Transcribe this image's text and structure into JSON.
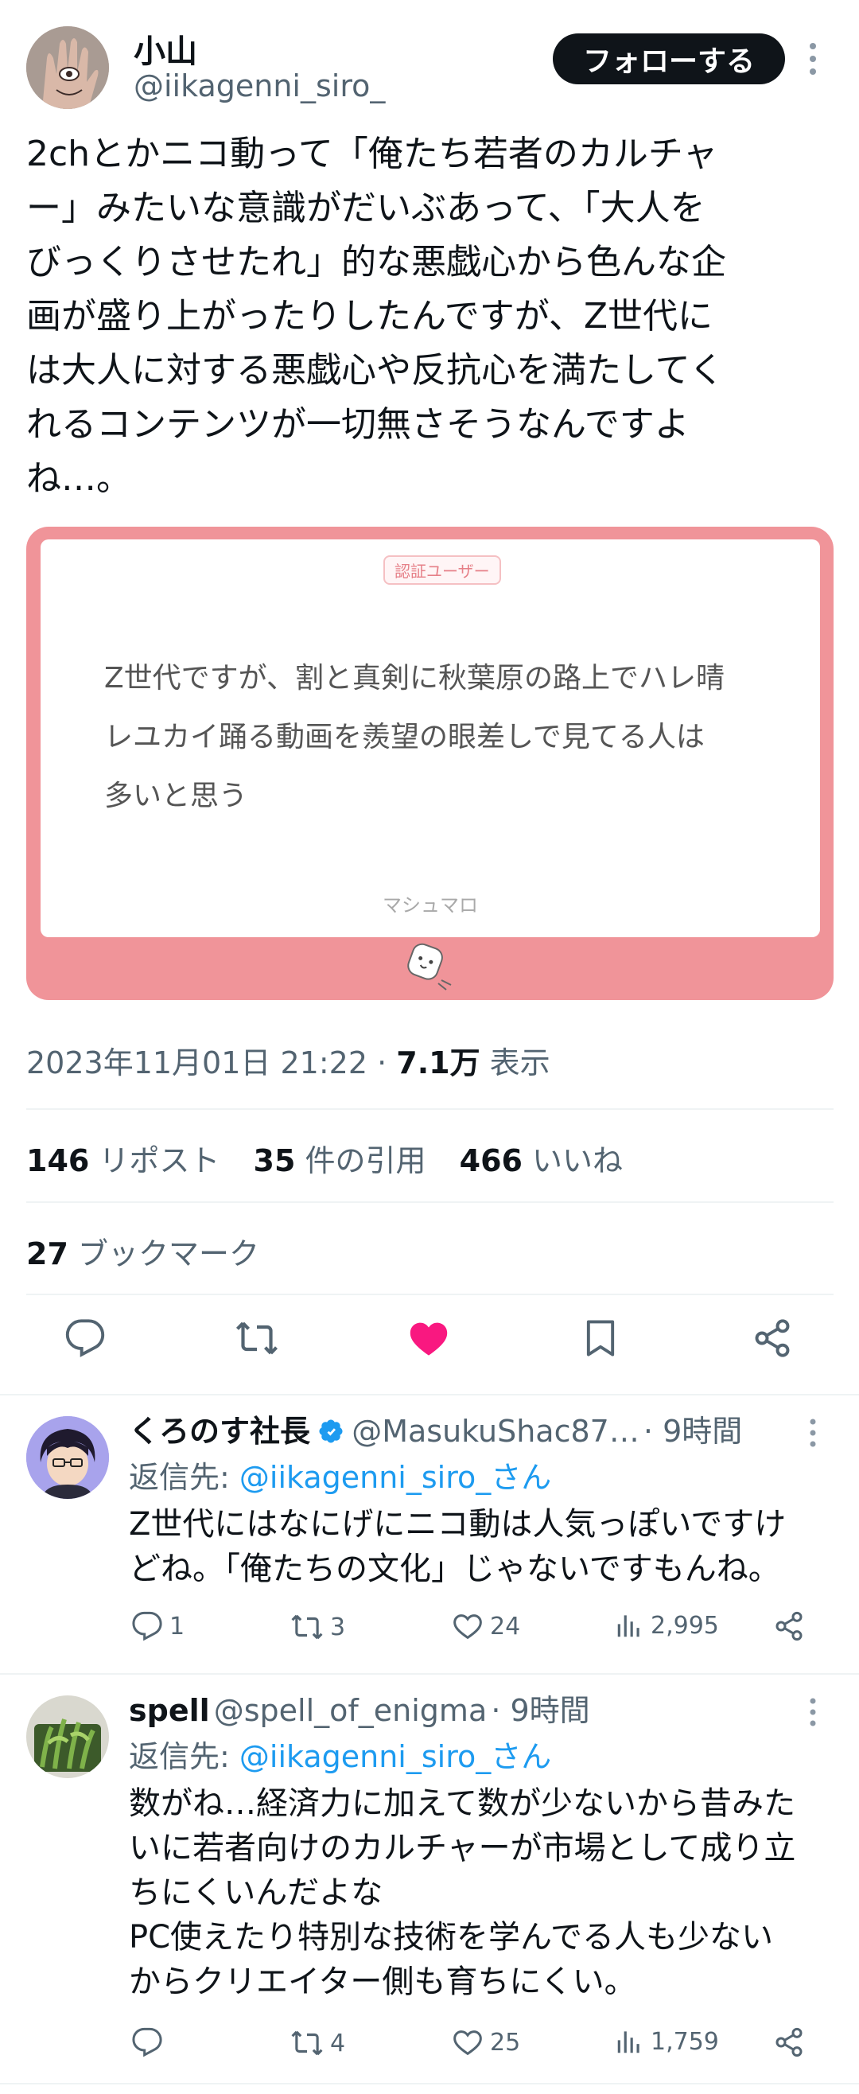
{
  "author": {
    "name": "小山",
    "handle": "@iikagenni_siro_",
    "follow_label": "フォローする"
  },
  "tweet": {
    "text": "2chとかニコ動って「俺たち若者のカルチャ\nー」みたいな意識がだいぶあって、「大人を\nびっくりさせたれ」的な悪戯心から色んな企\n画が盛り上がったりしたんですが、Z世代に\nは大人に対する悪戯心や反抗心を満たしてく\nれるコンテンツが一切無さそうなんですよ\nね…。",
    "card": {
      "badge": "認証ユーザー",
      "text": "Z世代ですが、割と真剣に秋葉原の路上でハレ晴\nレユカイ踊る動画を羨望の眼差しで見てる人は\n多いと思う",
      "footer": "マシュマロ"
    },
    "timestamp": "2023年11月01日 21:22 · ",
    "views_count": "7.1万",
    "views_label": " 表示",
    "stats": {
      "reposts_count": "146",
      "reposts_label": "リポスト",
      "quotes_count": "35",
      "quotes_label": "件の引用",
      "likes_count": "466",
      "likes_label": "いいね",
      "bookmarks_count": "27",
      "bookmarks_label": "ブックマーク"
    }
  },
  "colors": {
    "like_active": "#f91880",
    "link": "#1d9bf0",
    "card_bg": "#f09499"
  },
  "replies": [
    {
      "name": "くろのす社長",
      "verified": true,
      "handle": "@MasukuShac87…",
      "time": "· 9時間",
      "reply_to_prefix": "返信先: ",
      "reply_to_handle": "@iikagenni_siro_さん",
      "text": "Z世代にはなにげにニコ動は人気っぽいですけ\nどね。「俺たちの文化」じゃないですもんね。",
      "replies": "1",
      "reposts": "3",
      "likes": "24",
      "views": "2,995"
    },
    {
      "name": "spell",
      "verified": false,
      "handle": "@spell_of_enigma",
      "time": "· 9時間",
      "reply_to_prefix": "返信先: ",
      "reply_to_handle": "@iikagenni_siro_さん",
      "text": "数がね…経済力に加えて数が少ないから昔みた\nいに若者向けのカルチャーが市場として成り立\nちにくいんだよな\nPC使えたり特別な技術を学んでる人も少ない\nからクリエイター側も育ちにくい。",
      "replies": "",
      "reposts": "4",
      "likes": "25",
      "views": "1,759"
    }
  ]
}
